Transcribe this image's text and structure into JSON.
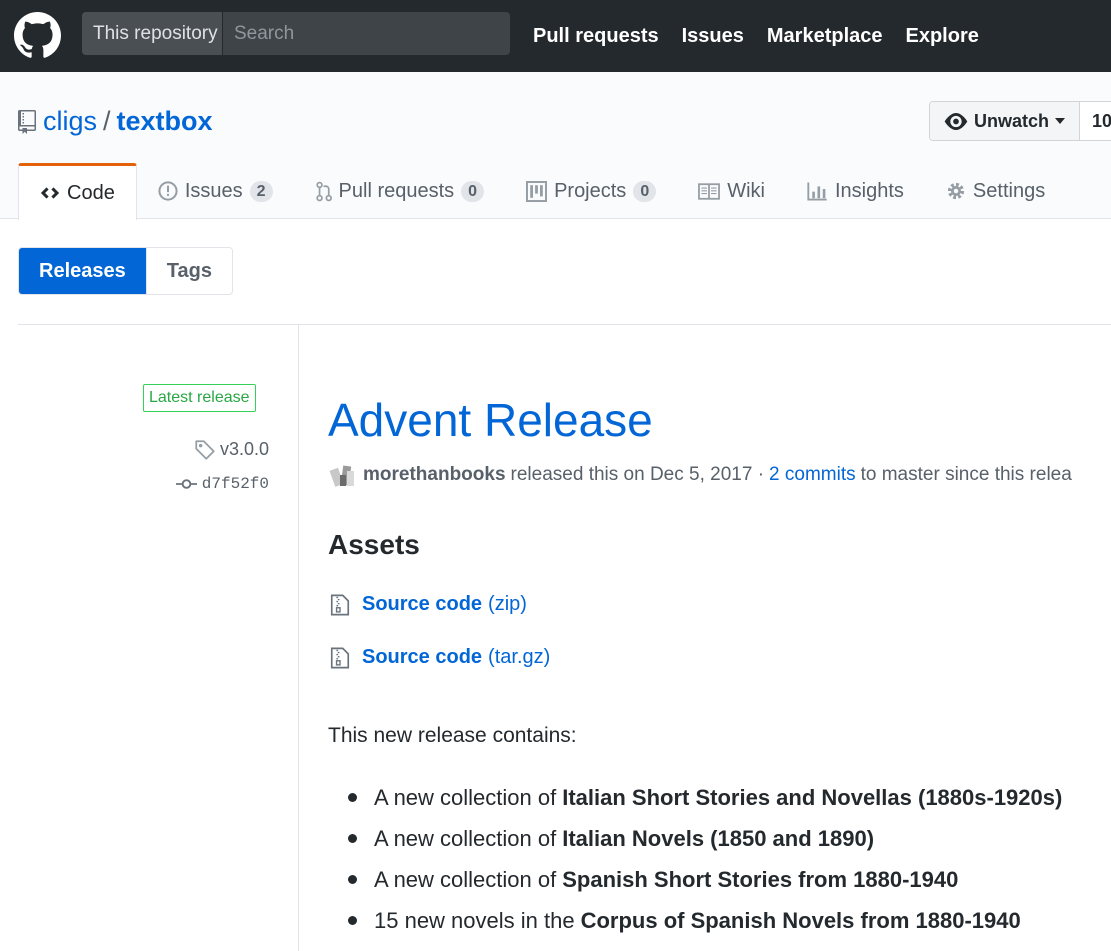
{
  "header": {
    "scope_label": "This repository",
    "search_placeholder": "Search",
    "nav": [
      "Pull requests",
      "Issues",
      "Marketplace",
      "Explore"
    ]
  },
  "repo": {
    "owner": "cligs",
    "separator": "/",
    "name": "textbox",
    "watch_label": "Unwatch",
    "watch_count": "10"
  },
  "tabs": [
    {
      "label": "Code",
      "icon": "code-icon"
    },
    {
      "label": "Issues",
      "count": "2",
      "icon": "issue-icon"
    },
    {
      "label": "Pull requests",
      "count": "0",
      "icon": "pull-request-icon"
    },
    {
      "label": "Projects",
      "count": "0",
      "icon": "project-icon"
    },
    {
      "label": "Wiki",
      "icon": "book-icon"
    },
    {
      "label": "Insights",
      "icon": "graph-icon"
    },
    {
      "label": "Settings",
      "icon": "gear-icon"
    }
  ],
  "subnav": {
    "releases": "Releases",
    "tags": "Tags"
  },
  "release": {
    "badge": "Latest release",
    "tag": "v3.0.0",
    "commit": "d7f52f0",
    "title": "Advent Release",
    "author": "morethanbooks",
    "released_text": "released this on Dec 5, 2017 ·",
    "commits_link": "2 commits",
    "since_text": "to master since this relea",
    "assets_heading": "Assets",
    "assets": [
      {
        "label": "Source code",
        "format": "(zip)"
      },
      {
        "label": "Source code",
        "format": "(tar.gz)"
      }
    ],
    "intro": "This new release contains:",
    "items": [
      {
        "prefix": "A new collection of",
        "bold": "Italian Short Stories and Novellas (1880s-1920s)"
      },
      {
        "prefix": "A new collection of",
        "bold": "Italian Novels (1850 and 1890)"
      },
      {
        "prefix": "A new collection of",
        "bold": "Spanish Short Stories from 1880-1940"
      },
      {
        "prefix": "15 new novels in the",
        "bold": "Corpus of Spanish Novels from 1880-1940"
      }
    ]
  },
  "colors": {
    "header_bg": "#24292e",
    "link": "#0366d6",
    "tab_accent": "#e36209",
    "badge_green": "#28a745"
  }
}
